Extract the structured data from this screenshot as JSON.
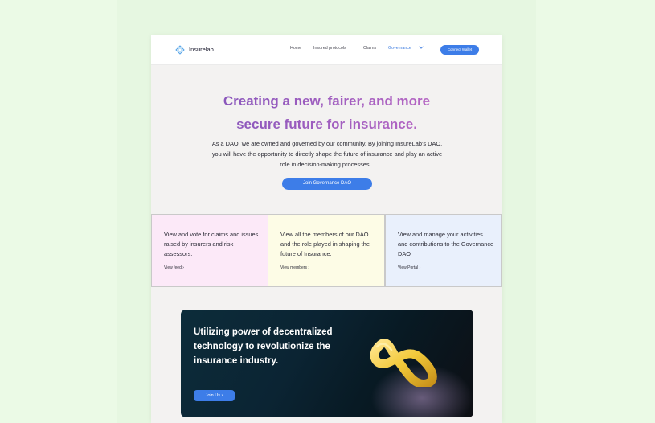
{
  "nav": {
    "brand": "Insurelab",
    "links": [
      "Home",
      "Insured protocols",
      "Claims",
      "Governance"
    ],
    "connect_label": "Connect Wallet"
  },
  "hero": {
    "title_line1": "Creating a new, fairer, and more",
    "title_line2": "secure future for insurance.",
    "description": "As a DAO, we are owned and governed by our community. By joining InsureLab's DAO, you will have the opportunity to directly shape the future of insurance and play an active role in decision-making processes. .",
    "cta_label": "Join Governance DAO"
  },
  "cards": [
    {
      "text": "View and vote for claims  and issues raised by insurers and risk assessors.",
      "link": "View feed  ›"
    },
    {
      "text": "View all the members of our DAO and the role played in shaping the future of Insurance.",
      "link": "View members  ›"
    },
    {
      "text": "View and manage your activities and contributions to the Governance DAO",
      "link": "View Portal  ›"
    }
  ],
  "banner": {
    "text": "Utilizing power of decentralized technology to revolutionize the insurance industry.",
    "cta_label": "Join Us  ›"
  },
  "colors": {
    "accent": "#3d7de8",
    "card_pink": "#fce9f8",
    "card_yellow": "#fdfce6",
    "card_blue": "#e9f0fc",
    "title_gradient": [
      "#7b52b9",
      "#c46bc6"
    ]
  },
  "icons": [
    "insurelab-logo-icon",
    "chevron-down-icon",
    "infinity-3d-icon"
  ]
}
